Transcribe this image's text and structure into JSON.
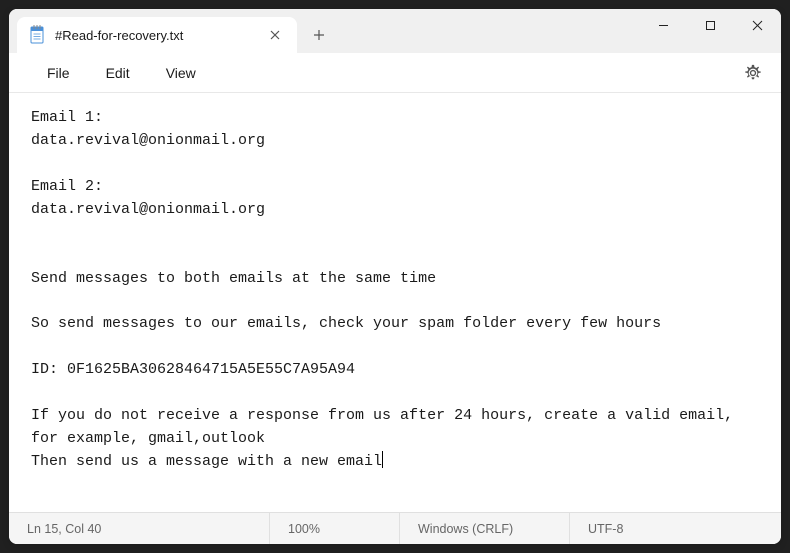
{
  "tab": {
    "title": "#Read-for-recovery.txt"
  },
  "menu": {
    "file": "File",
    "edit": "Edit",
    "view": "View"
  },
  "document": {
    "text": "Email 1:\ndata.revival@onionmail.org\n\nEmail 2:\ndata.revival@onionmail.org\n\n\nSend messages to both emails at the same time\n\nSo send messages to our emails, check your spam folder every few hours\n\nID: 0F1625BA30628464715A5E55C7A95A94\n\nIf you do not receive a response from us after 24 hours, create a valid email, for example, gmail,outlook\nThen send us a message with a new email"
  },
  "statusbar": {
    "position": "Ln 15, Col 40",
    "zoom": "100%",
    "line_ending": "Windows (CRLF)",
    "encoding": "UTF-8"
  }
}
